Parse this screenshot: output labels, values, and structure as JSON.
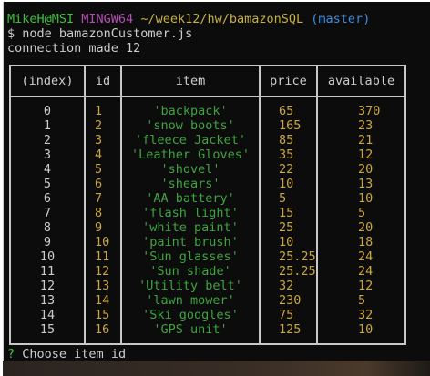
{
  "prompt": {
    "user": "MikeH@MSI",
    "system": "MINGW64",
    "path": "~/week12/hw/bamazonSQL",
    "branch": "(master)"
  },
  "command": "$ node bamazonCustomer.js",
  "output_line": "connection made 12",
  "table": {
    "headers": [
      "(index)",
      "id",
      "item",
      "price",
      "available"
    ],
    "rows": [
      [
        "0",
        "1",
        "'backpack'",
        "65",
        "370"
      ],
      [
        "1",
        "2",
        "'snow boots'",
        "165",
        "23"
      ],
      [
        "2",
        "3",
        "'fleece Jacket'",
        "85",
        "21"
      ],
      [
        "3",
        "4",
        "'Leather Gloves'",
        "35",
        "12"
      ],
      [
        "4",
        "5",
        "'shovel'",
        "22",
        "20"
      ],
      [
        "5",
        "6",
        "'shears'",
        "10",
        "13"
      ],
      [
        "6",
        "7",
        "'AA battery'",
        "5",
        "10"
      ],
      [
        "7",
        "8",
        "'flash light'",
        "15",
        "5"
      ],
      [
        "8",
        "9",
        "'white paint'",
        "25",
        "20"
      ],
      [
        "9",
        "10",
        "'paint brush'",
        "10",
        "18"
      ],
      [
        "10",
        "11",
        "'Sun glasses'",
        "25.25",
        "24"
      ],
      [
        "11",
        "12",
        "'Sun shade'",
        "25.25",
        "24"
      ],
      [
        "12",
        "13",
        "'Utility belt'",
        "32",
        "12"
      ],
      [
        "13",
        "14",
        "'lawn mower'",
        "230",
        "5"
      ],
      [
        "14",
        "15",
        "'Ski googles'",
        "75",
        "32"
      ],
      [
        "15",
        "16",
        "'GPS unit'",
        "125",
        "10"
      ]
    ]
  },
  "question": {
    "mark": "?",
    "text": "Choose item id"
  }
}
